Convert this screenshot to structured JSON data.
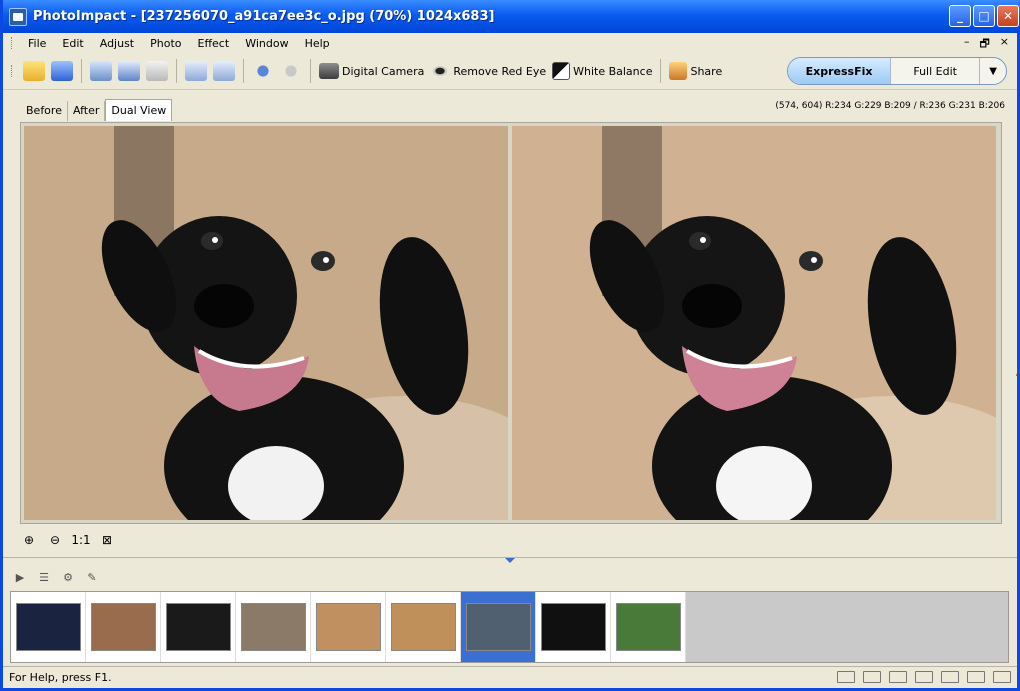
{
  "window": {
    "title": "PhotoImpact - [237256070_a91ca7ee3c_o.jpg (70%) 1024x683]",
    "controls": [
      "_",
      "□",
      "✕"
    ]
  },
  "menu": {
    "items": [
      "File",
      "Edit",
      "Adjust",
      "Photo",
      "Effect",
      "Window",
      "Help"
    ],
    "right_controls": [
      "–",
      "🗗",
      "×"
    ]
  },
  "toolbar": {
    "digital_camera": "Digital Camera",
    "remove_red_eye": "Remove Red Eye",
    "white_balance": "White Balance",
    "share": "Share"
  },
  "mode": {
    "expressfix": "ExpressFix",
    "full_edit": "Full Edit",
    "dropdown": "▼"
  },
  "view": {
    "tabs": [
      "Before",
      "After",
      "Dual View"
    ],
    "active_tab": "Dual View",
    "pixel_info": "(574, 604) R:234 G:229 B:209 / R:236 G:231 B:206"
  },
  "zoom": {
    "zoom_in": "⊕",
    "zoom_out": "⊖",
    "actual_size": "1:1",
    "fit": "⊠"
  },
  "filmstrip": {
    "thumbnails": [
      {
        "label": "night-lights-thumbnail",
        "color": "#1a2440"
      },
      {
        "label": "bedroom-thumbnail",
        "color": "#9a6c4e"
      },
      {
        "label": "red-object-thumbnail",
        "color": "#1a1a1a"
      },
      {
        "label": "street-thumbnail",
        "color": "#8b7a68"
      },
      {
        "label": "cat-thumbnail",
        "color": "#c09060"
      },
      {
        "label": "dog-pair-thumbnail",
        "color": "#c0905a"
      },
      {
        "label": "dog-thumbnail",
        "color": "#506070"
      },
      {
        "label": "guitarist-thumbnail",
        "color": "#101010"
      },
      {
        "label": "trees-thumbnail",
        "color": "#4a7a3a"
      }
    ],
    "selected_index": 6
  },
  "status": {
    "text": "For Help, press F1."
  }
}
